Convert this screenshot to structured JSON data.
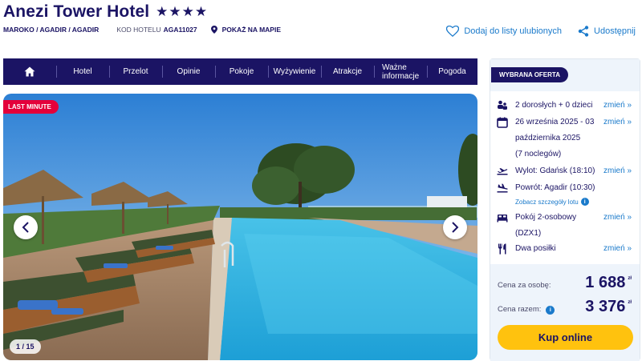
{
  "hotel": {
    "name": "Anezi Tower Hotel",
    "stars": "★★★★",
    "location": "MAROKO / AGADIR / AGADIR",
    "code_label": "KOD HOTELU",
    "code": "AGA11027",
    "map_link": "POKAŻ NA MAPIE"
  },
  "actions": {
    "favorite": "Dodaj do listy ulubionych",
    "share": "Udostępnij"
  },
  "nav": {
    "items": [
      "Hotel",
      "Przelot",
      "Opinie",
      "Pokoje",
      "Wyżywienie",
      "Atrakcje",
      "Ważne informacje",
      "Pogoda"
    ],
    "item_6_line1": "Ważne",
    "item_6_line2": "informacje"
  },
  "gallery": {
    "badge": "LAST MINUTE",
    "counter": "1 / 15"
  },
  "offer": {
    "badge": "WYBRANA OFERTA",
    "change_label": "zmień »",
    "guests": "2 dorosłych + 0 dzieci",
    "dates_line1": "26 września 2025 - 03",
    "dates_line2": "października 2025",
    "nights": "(7 noclegów)",
    "departure": "Wylot: Gdańsk (18:10)",
    "return": "Powrót: Agadir (10:30)",
    "flight_details": "Zobacz szczegóły lotu",
    "room_line1": "Pokój 2-osobowy",
    "room_line2": "(DZX1)",
    "board": "Dwa posiłki",
    "price_person_label": "Cena za osobę:",
    "price_person": "1 688",
    "price_total_label": "Cena razem:",
    "price_total": "3 376",
    "currency": "zł",
    "buy": "Kup online"
  },
  "colors": {
    "brand_navy": "#1b1464",
    "link_blue": "#1a7acb",
    "badge_red": "#e4003a",
    "cta_yellow": "#ffc20e"
  }
}
